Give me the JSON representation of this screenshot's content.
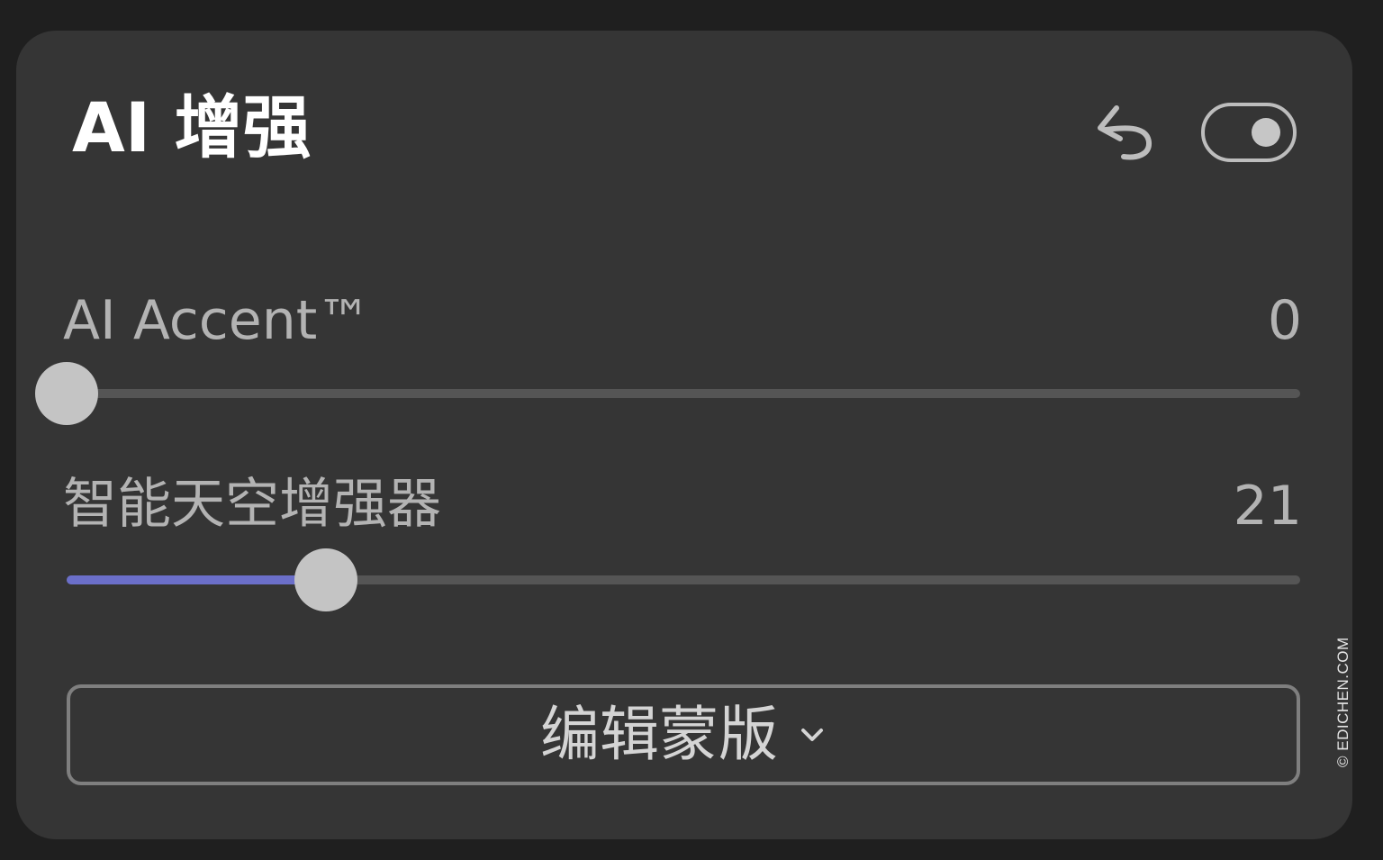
{
  "panel": {
    "title": "AI 增强",
    "toggle_on": true,
    "undo_icon": "undo-icon",
    "toggle_icon": "toggle-switch"
  },
  "sliders": [
    {
      "label": "AI Accent™",
      "value": "0",
      "fraction": 0.0
    },
    {
      "label": "智能天空增强器",
      "value": "21",
      "fraction": 0.21
    }
  ],
  "mask_button": {
    "label": "编辑蒙版",
    "icon": "chevron-down-icon"
  },
  "watermark": "© EDICHEN.COM",
  "colors": {
    "panel_bg": "#353535",
    "page_bg": "#1f1f1f",
    "accent": "#6b6fc9",
    "track": "#555555",
    "thumb": "#c4c4c4"
  }
}
